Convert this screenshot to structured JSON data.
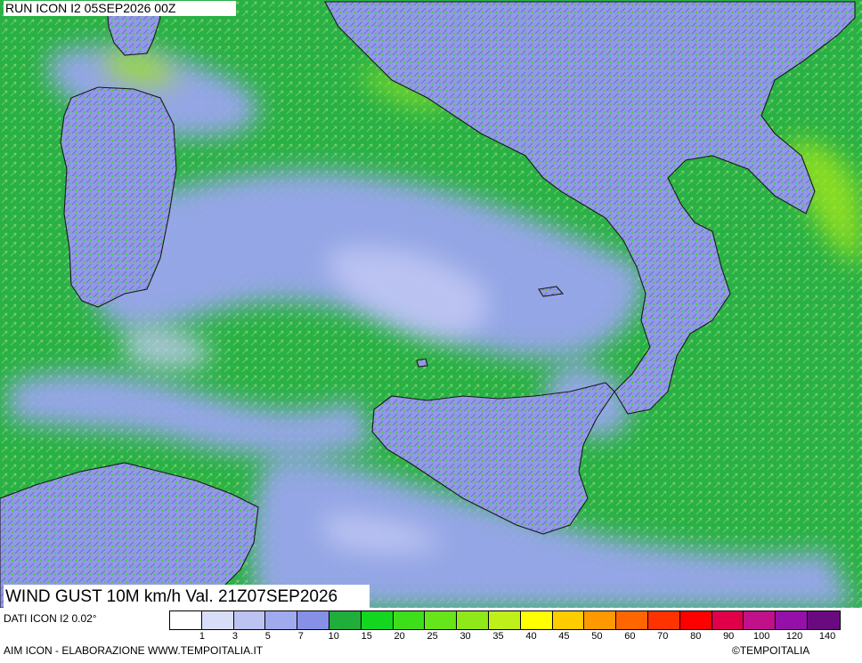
{
  "header": {
    "run_label": "RUN ICON I2 05SEP2026 00Z"
  },
  "map": {
    "title": "WIND GUST 10M km/h Val. 21Z07SEP2026",
    "colors": {
      "sea_green": "#29b146",
      "calm_blue": "#9aa6ee",
      "calm_light": "#c4caf5",
      "land": "#8f96e6",
      "coast": "#1a1a1a",
      "gust_yellow": "#9fe61a"
    }
  },
  "legend": {
    "source_label": "DATI ICON I2 0.02°",
    "colors": [
      "#ffffff",
      "#d9def8",
      "#bcc3f2",
      "#a0aaee",
      "#8590e6",
      "#1fae3a",
      "#13d61f",
      "#3cdf1a",
      "#66e51a",
      "#8fe81a",
      "#bff01a",
      "#ffff00",
      "#ffcc00",
      "#ff9900",
      "#ff6600",
      "#ff3300",
      "#ff0000",
      "#e0004a",
      "#c0108a",
      "#9410a8",
      "#6a0a80"
    ],
    "ticks": [
      "1",
      "3",
      "5",
      "7",
      "10",
      "15",
      "20",
      "25",
      "30",
      "35",
      "40",
      "45",
      "50",
      "60",
      "70",
      "80",
      "90",
      "100",
      "120",
      "140"
    ]
  },
  "footer": {
    "left": "AIM ICON - ELABORAZIONE WWW.TEMPOITALIA.IT",
    "right": "TEMPOITALIA",
    "copyright_icon": "copyright-icon"
  }
}
